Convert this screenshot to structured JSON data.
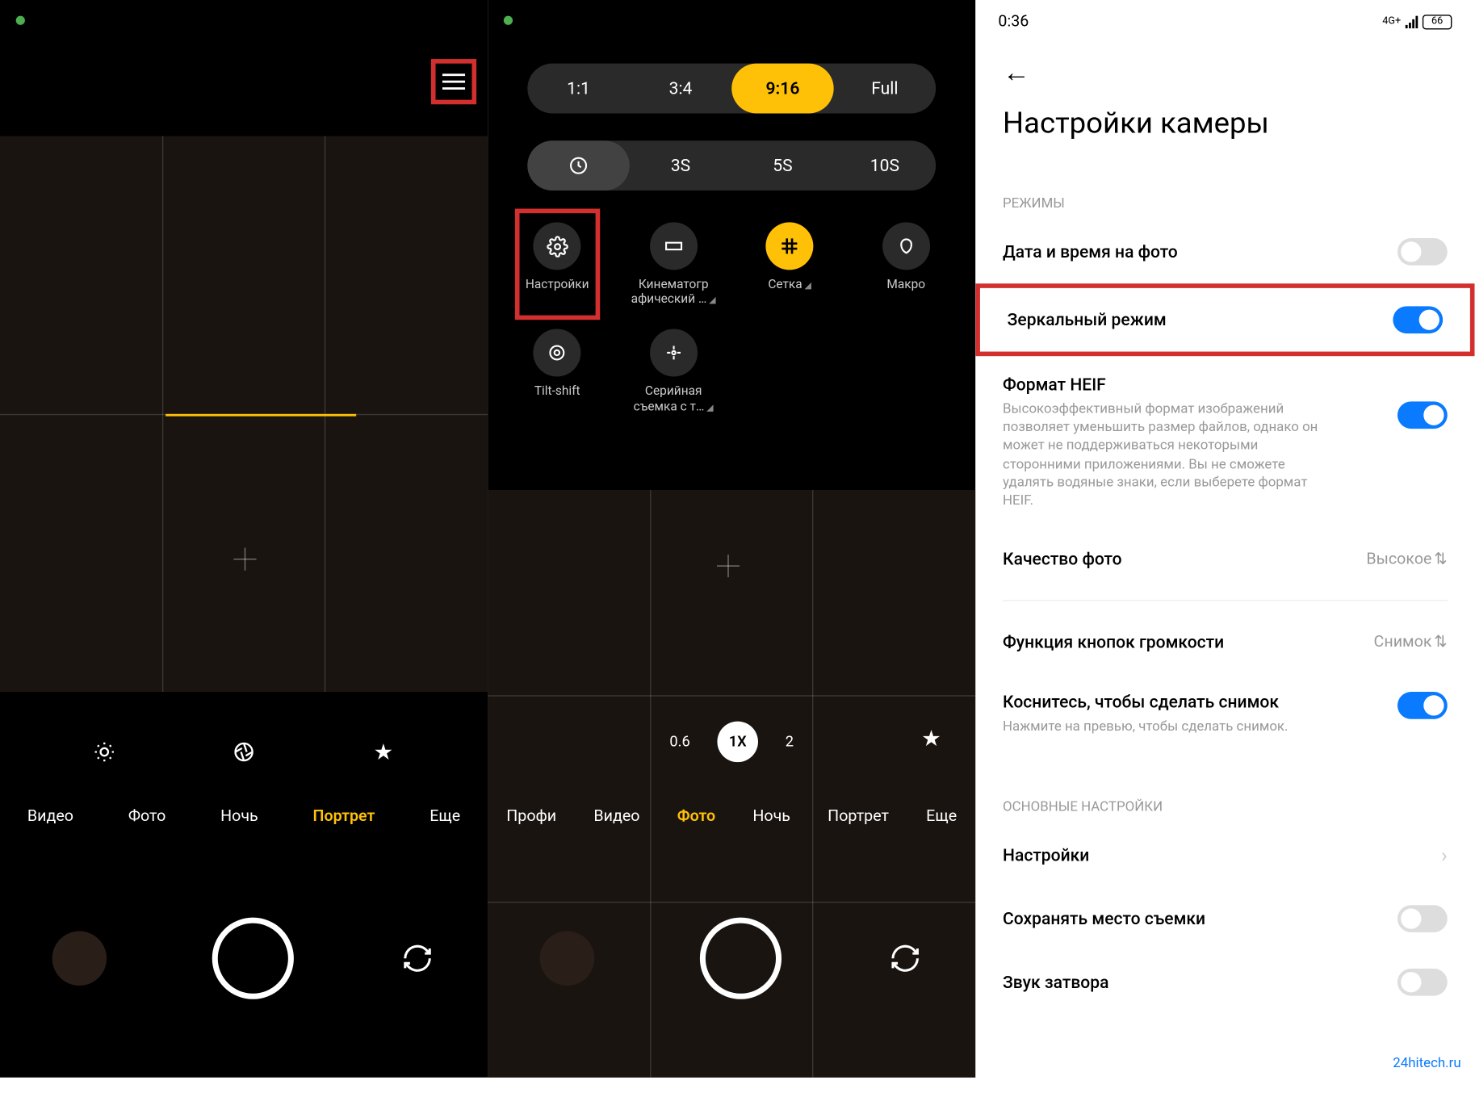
{
  "pane1": {
    "modes": {
      "items": [
        "Видео",
        "Фото",
        "Ночь",
        "Портрет",
        "Еще"
      ],
      "active": "Портрет"
    }
  },
  "pane2": {
    "ratio": {
      "options": [
        "1:1",
        "3:4",
        "9:16",
        "Full"
      ],
      "active": "9:16"
    },
    "timer": {
      "options": [
        "clock",
        "3S",
        "5S",
        "10S"
      ],
      "active": "clock"
    },
    "tools": [
      {
        "label": "Настройки",
        "icon": "gear",
        "highlight": true
      },
      {
        "label": "Кинематогр афический …",
        "icon": "film",
        "tri": true
      },
      {
        "label": "Сетка",
        "icon": "grid",
        "active": true,
        "tri": true
      },
      {
        "label": "Макро",
        "icon": "macro"
      },
      {
        "label": "Tilt-shift",
        "icon": "target"
      },
      {
        "label": "Серийная съемка с т…",
        "icon": "burst",
        "tri": true
      }
    ],
    "zoom": {
      "options": [
        "0.6",
        "1X",
        "2"
      ],
      "active": "1X"
    },
    "modes": {
      "items": [
        "Профи",
        "Видео",
        "Фото",
        "Ночь",
        "Портрет",
        "Еще"
      ],
      "active": "Фото"
    }
  },
  "pane3": {
    "status": {
      "time": "0:36",
      "net": "4G+",
      "battery": "66"
    },
    "title": "Настройки камеры",
    "sections": {
      "modes_label": "РЕЖИМЫ",
      "main_label": "ОСНОВНЫЕ НАСТРОЙКИ"
    },
    "rows": {
      "date": {
        "title": "Дата и время на фото",
        "on": false
      },
      "mirror": {
        "title": "Зеркальный режим",
        "on": true,
        "highlight": true
      },
      "heif": {
        "title": "Формат HEIF",
        "desc": "Высокоэффективный формат изображений позволяет уменьшить размер файлов, однако он может не поддерживаться некоторыми сторонними приложениями. Вы не сможете удалять водяные знаки, если выберете формат HEIF.",
        "on": true
      },
      "quality": {
        "title": "Качество фото",
        "value": "Высокое"
      },
      "volume": {
        "title": "Функция кнопок громкости",
        "value": "Снимок"
      },
      "tap": {
        "title": "Коснитесь, чтобы сделать снимок",
        "desc": "Нажмите на превью, чтобы сделать снимок.",
        "on": true
      },
      "nav": {
        "title": "Настройки"
      },
      "location": {
        "title": "Сохранять место съемки",
        "on": false
      },
      "sound": {
        "title": "Звук затвора",
        "on": false
      }
    },
    "watermark": "24hitech.ru"
  }
}
